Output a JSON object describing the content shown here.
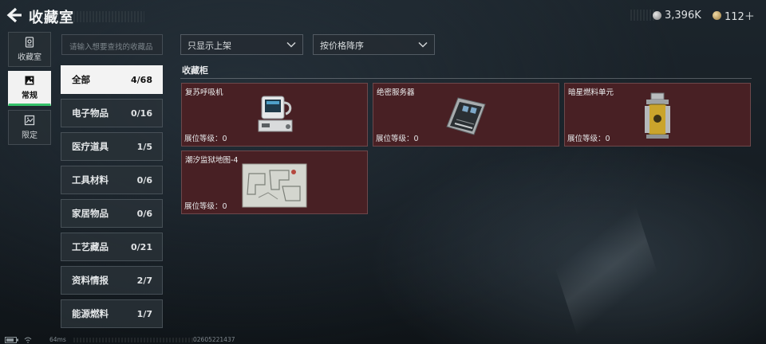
{
  "header": {
    "title": "收藏室",
    "currency": [
      {
        "icon": "silver-coin-icon",
        "value": "3,396K"
      },
      {
        "icon": "gold-coin-icon",
        "value": "112＋"
      }
    ]
  },
  "vnav": [
    {
      "label": "收藏室",
      "icon": "collection-room-icon",
      "active": false
    },
    {
      "label": "常规",
      "icon": "regular-icon",
      "active": true
    },
    {
      "label": "限定",
      "icon": "limited-icon",
      "active": false
    }
  ],
  "search": {
    "placeholder": "请输入想要查找的收藏品"
  },
  "categories": [
    {
      "label": "全部",
      "count": "4/68",
      "active": true
    },
    {
      "label": "电子物品",
      "count": "0/16"
    },
    {
      "label": "医疗道具",
      "count": "1/5"
    },
    {
      "label": "工具材料",
      "count": "0/6"
    },
    {
      "label": "家居物品",
      "count": "0/6"
    },
    {
      "label": "工艺藏品",
      "count": "0/21"
    },
    {
      "label": "资料情报",
      "count": "2/7"
    },
    {
      "label": "能源燃料",
      "count": "1/7"
    }
  ],
  "filters": {
    "show_filter": "只显示上架",
    "sort_filter": "按价格降序"
  },
  "section": {
    "title": "收藏柜"
  },
  "items": [
    {
      "name": "复苏呼吸机",
      "grade": "展位等级：0",
      "icon": "respirator-machine-icon"
    },
    {
      "name": "绝密服务器",
      "grade": "展位等级：0",
      "icon": "server-icon"
    },
    {
      "name": "暗星燃料单元",
      "grade": "展位等级：0",
      "icon": "fuel-cell-icon"
    },
    {
      "name": "潮汐监狱地图-4",
      "grade": "展位等级：0",
      "icon": "map-icon"
    }
  ],
  "status": {
    "ping": "64ms",
    "uid": "02605221437"
  },
  "colors": {
    "accent_green": "#35c26a",
    "card_bg": "#482024"
  }
}
